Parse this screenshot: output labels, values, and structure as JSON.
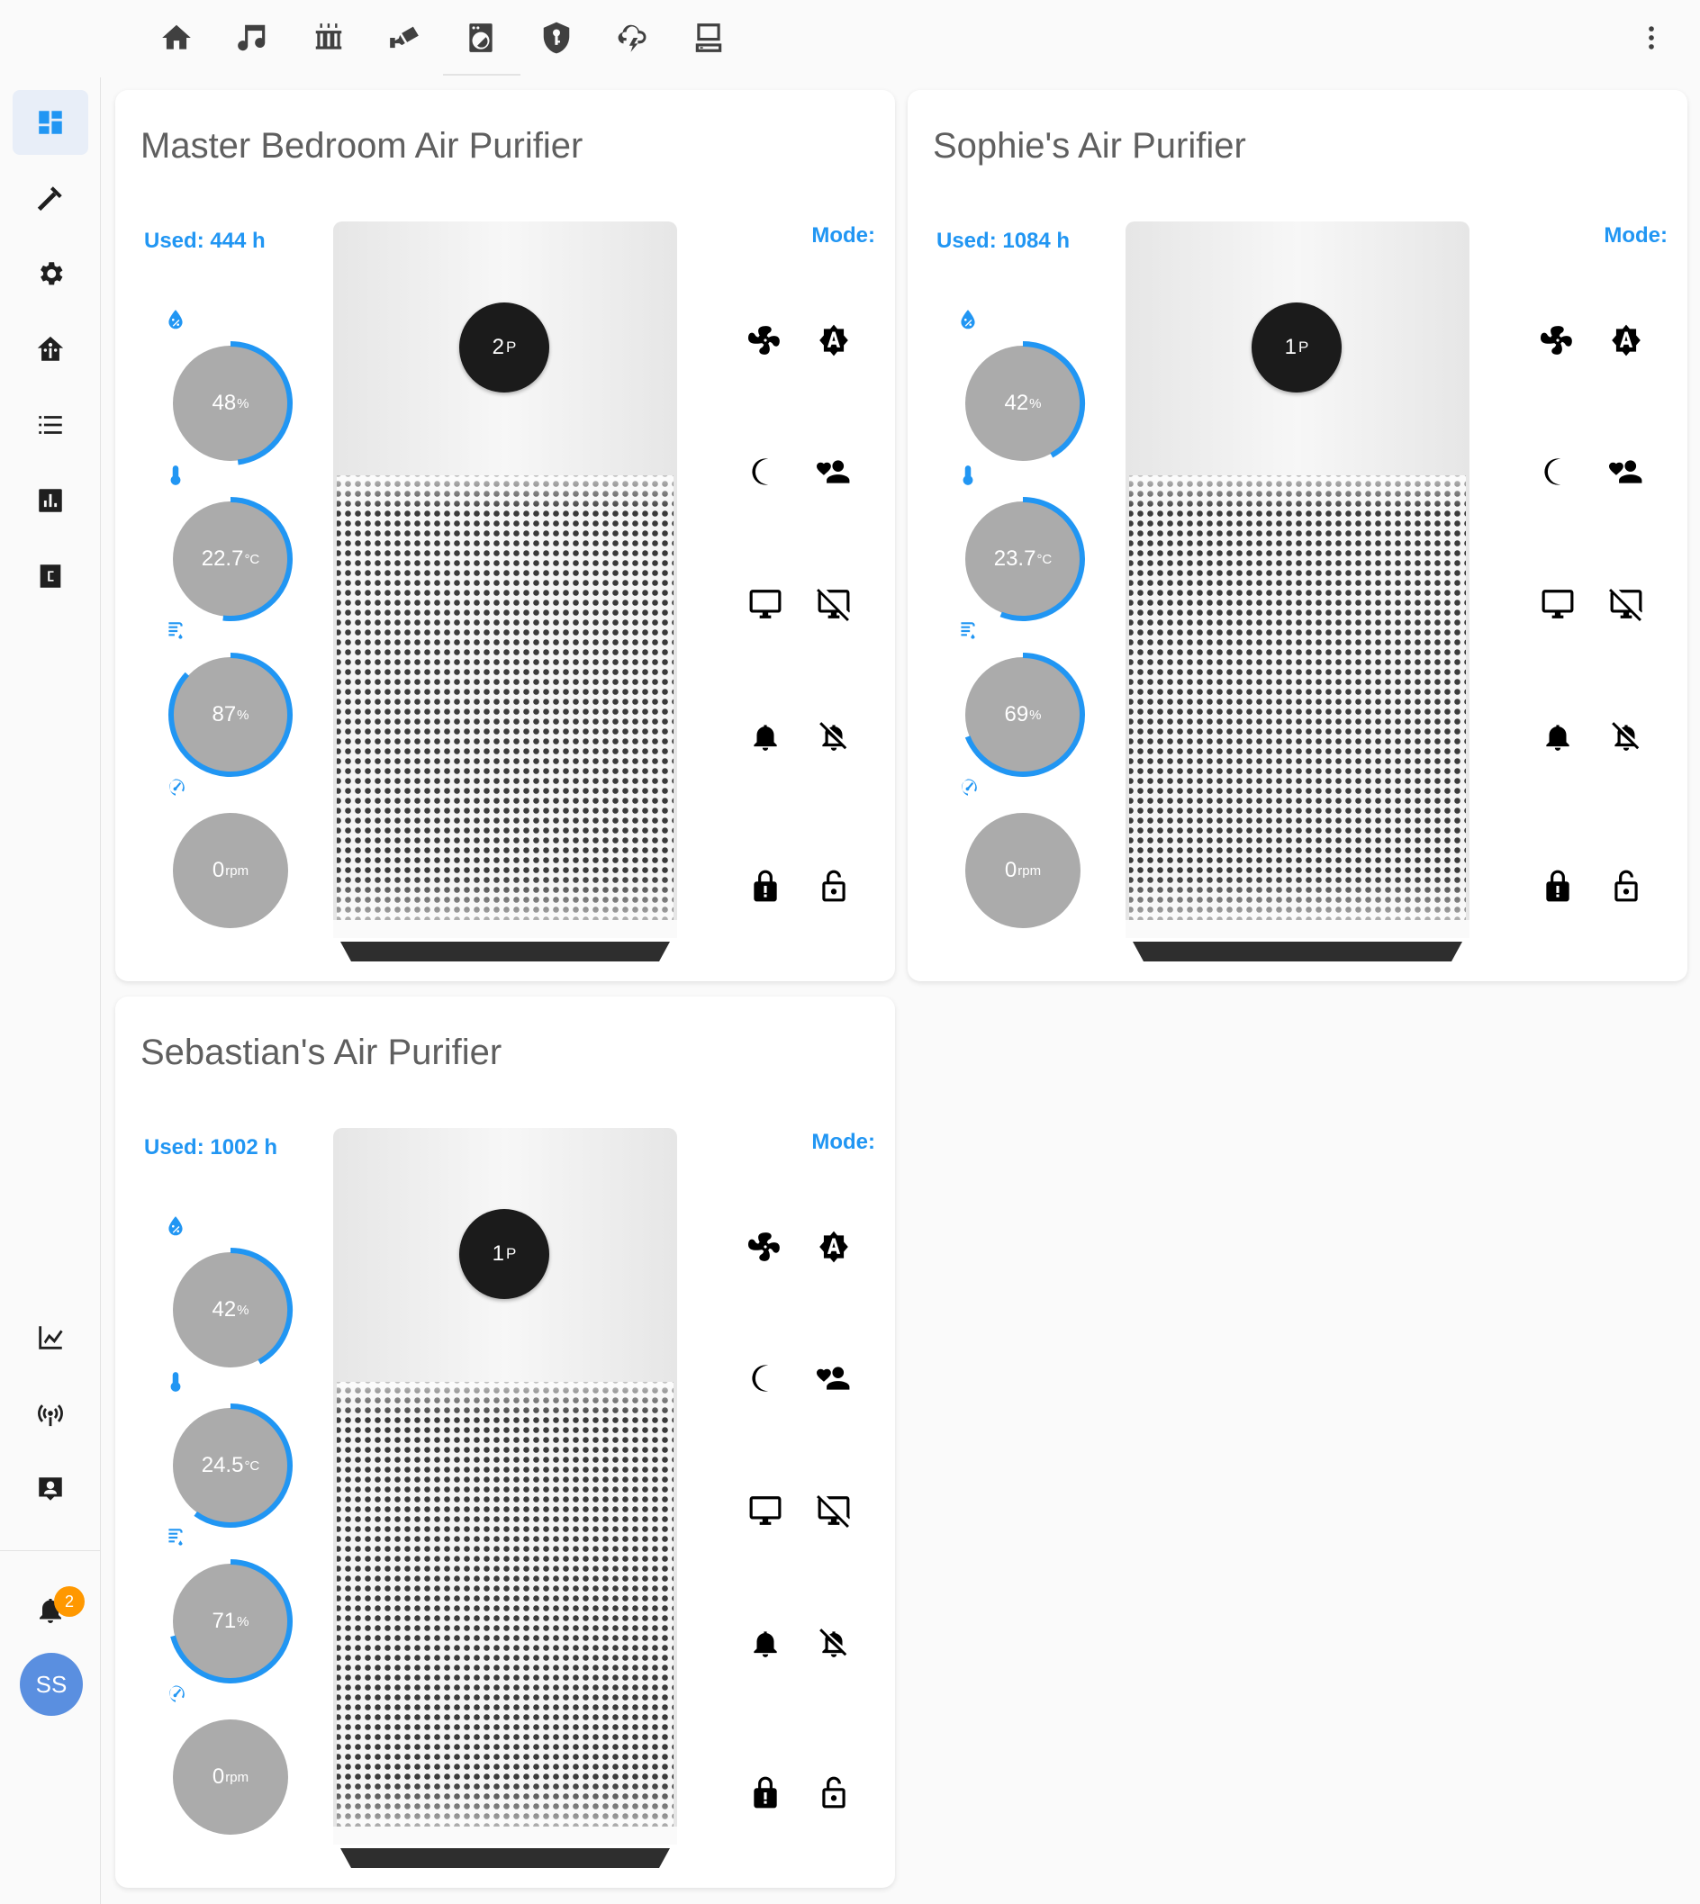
{
  "top_tabs": [
    {
      "name": "home"
    },
    {
      "name": "music"
    },
    {
      "name": "heater"
    },
    {
      "name": "cctv"
    },
    {
      "name": "washing-machine"
    },
    {
      "name": "security"
    },
    {
      "name": "weather"
    },
    {
      "name": "server"
    }
  ],
  "sidebar": {
    "notification_count": "2",
    "avatar_initials": "SS"
  },
  "cards": [
    {
      "title": "Master Bedroom Air Purifier",
      "used": "Used: 444 h",
      "mode_label": "Mode:",
      "display_value": "2",
      "display_unit": "P",
      "humidity": "48",
      "humidity_unit": "%",
      "humidity_pct": 0.48,
      "temperature": "22.7",
      "temperature_unit": "°C",
      "temperature_pct": 0.52,
      "filter": "87",
      "filter_unit": "%",
      "filter_pct": 0.87,
      "fan_speed": "0",
      "fan_speed_unit": "rpm",
      "fan_speed_pct": 0
    },
    {
      "title": "Sophie's Air Purifier",
      "used": "Used: 1084 h",
      "mode_label": "Mode:",
      "display_value": "1",
      "display_unit": "P",
      "humidity": "42",
      "humidity_unit": "%",
      "humidity_pct": 0.42,
      "temperature": "23.7",
      "temperature_unit": "°C",
      "temperature_pct": 0.56,
      "filter": "69",
      "filter_unit": "%",
      "filter_pct": 0.69,
      "fan_speed": "0",
      "fan_speed_unit": "rpm",
      "fan_speed_pct": 0
    },
    {
      "title": "Sebastian's Air Purifier",
      "used": "Used: 1002 h",
      "mode_label": "Mode:",
      "display_value": "1",
      "display_unit": "P",
      "humidity": "42",
      "humidity_unit": "%",
      "humidity_pct": 0.42,
      "temperature": "24.5",
      "temperature_unit": "°C",
      "temperature_pct": 0.6,
      "filter": "71",
      "filter_unit": "%",
      "filter_pct": 0.71,
      "fan_speed": "0",
      "fan_speed_unit": "rpm",
      "fan_speed_pct": 0
    }
  ],
  "colors": {
    "accent": "#2196f3",
    "gauge_fill": "#ababab",
    "badge": "#ff9800",
    "avatar": "#5a8fe0"
  }
}
